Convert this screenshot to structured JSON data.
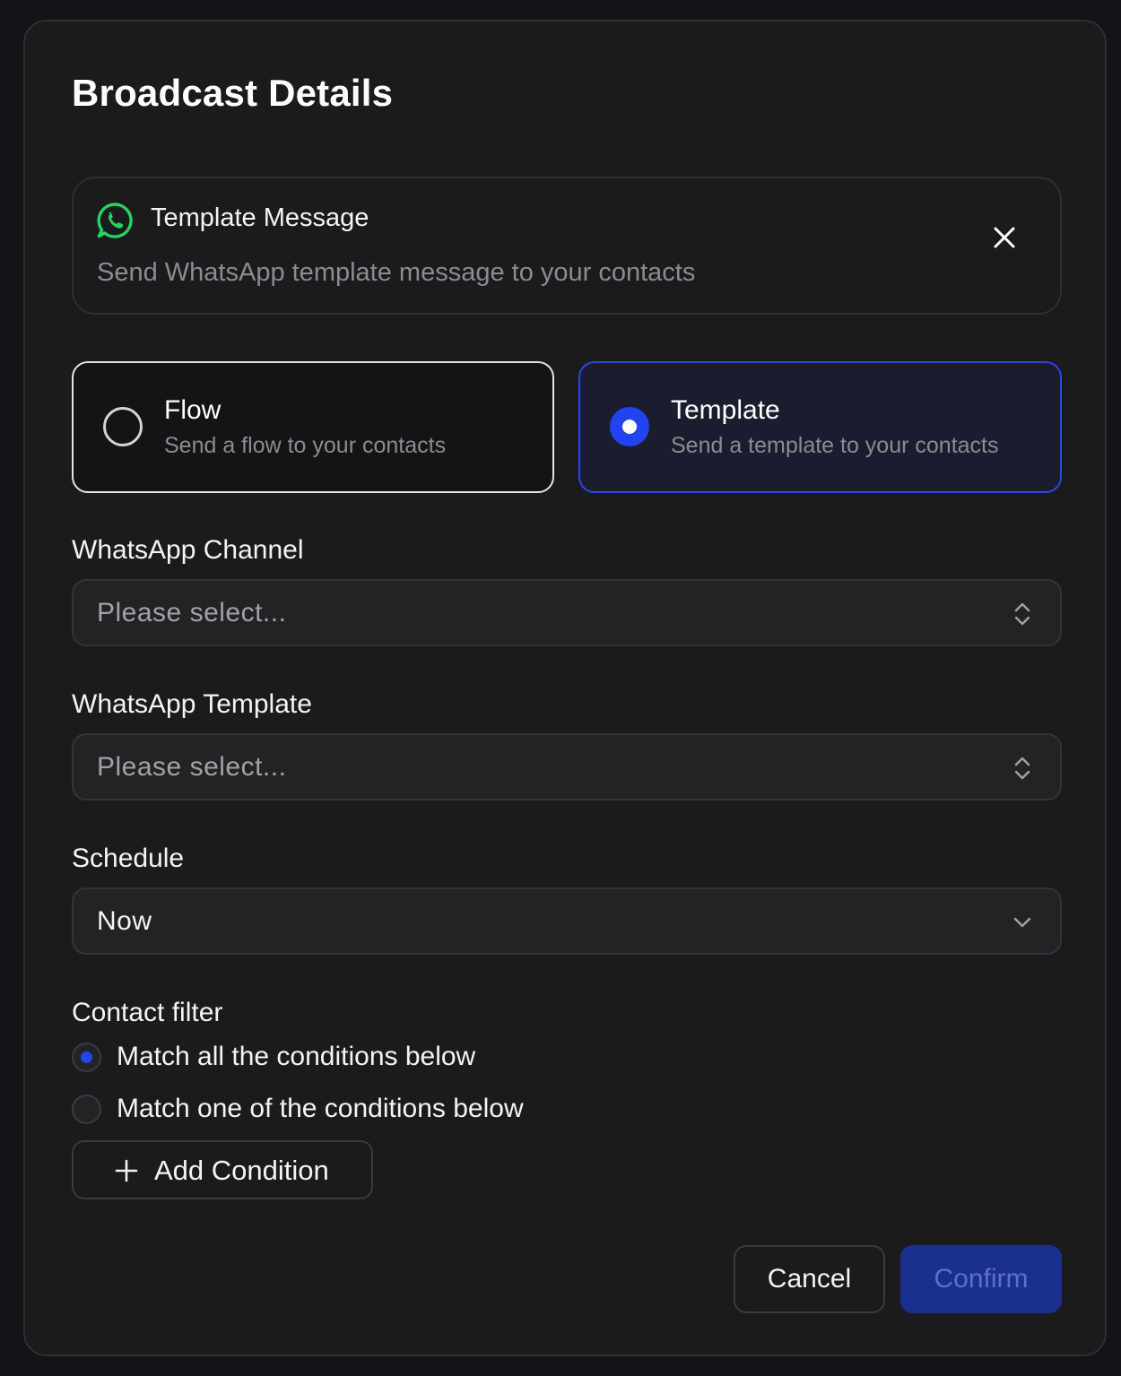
{
  "dialog": {
    "title": "Broadcast Details"
  },
  "info_card": {
    "icon": "whatsapp-icon",
    "title": "Template Message",
    "description": "Send WhatsApp template message to your contacts",
    "close_icon": "close-icon"
  },
  "message_type": {
    "options": [
      {
        "title": "Flow",
        "description": "Send a flow to your contacts",
        "selected": false
      },
      {
        "title": "Template",
        "description": "Send a template to your contacts",
        "selected": true
      }
    ]
  },
  "channel": {
    "label": "WhatsApp Channel",
    "placeholder": "Please select..."
  },
  "template": {
    "label": "WhatsApp Template",
    "placeholder": "Please select..."
  },
  "schedule": {
    "label": "Schedule",
    "value": "Now"
  },
  "contact_filter": {
    "label": "Contact filter",
    "options": [
      {
        "label": "Match all the conditions below",
        "checked": true
      },
      {
        "label": "Match one of the conditions below",
        "checked": false
      }
    ],
    "add_condition_label": "Add Condition"
  },
  "footer": {
    "cancel_label": "Cancel",
    "confirm_label": "Confirm"
  },
  "colors": {
    "background": "#13131a",
    "dialog": "#1b1b1e",
    "accent": "#2143f0",
    "whatsapp": "#25d366",
    "confirm_disabled": "#1b2f8c"
  }
}
